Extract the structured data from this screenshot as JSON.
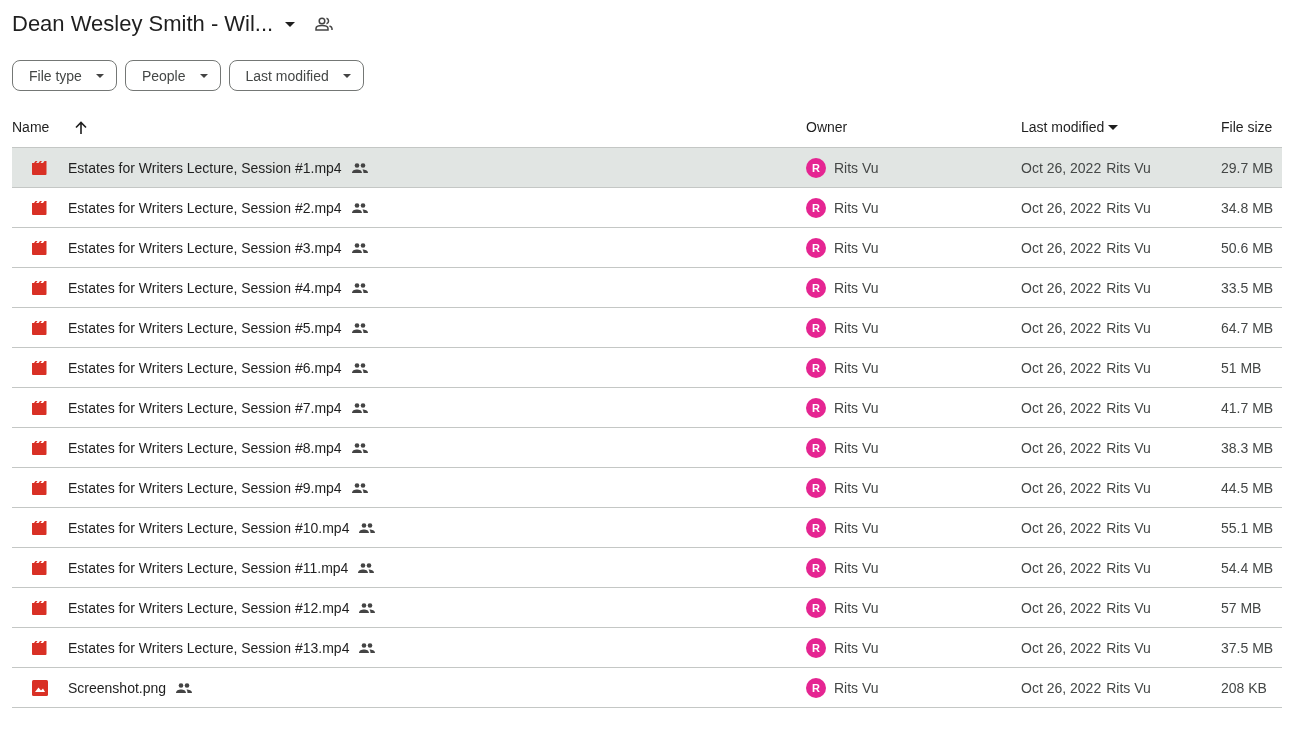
{
  "folder": {
    "title": "Dean Wesley Smith - Wil..."
  },
  "filters": [
    {
      "label": "File type"
    },
    {
      "label": "People"
    },
    {
      "label": "Last modified"
    }
  ],
  "table": {
    "columns": [
      {
        "label": "Name"
      },
      {
        "label": "Owner"
      },
      {
        "label": "Last modified"
      },
      {
        "label": "File size"
      }
    ],
    "rows": [
      {
        "kind": "video",
        "name": "Estates for Writers Lecture, Session #1.mp4",
        "owner_initial": "R",
        "owner": "Rits Vu",
        "modified": "Oct 26, 2022",
        "modified_by": "Rits Vu",
        "size": "29.7 MB",
        "selected": true
      },
      {
        "kind": "video",
        "name": "Estates for Writers Lecture, Session #2.mp4",
        "owner_initial": "R",
        "owner": "Rits Vu",
        "modified": "Oct 26, 2022",
        "modified_by": "Rits Vu",
        "size": "34.8 MB",
        "selected": false
      },
      {
        "kind": "video",
        "name": "Estates for Writers Lecture, Session #3.mp4",
        "owner_initial": "R",
        "owner": "Rits Vu",
        "modified": "Oct 26, 2022",
        "modified_by": "Rits Vu",
        "size": "50.6 MB",
        "selected": false
      },
      {
        "kind": "video",
        "name": "Estates for Writers Lecture, Session #4.mp4",
        "owner_initial": "R",
        "owner": "Rits Vu",
        "modified": "Oct 26, 2022",
        "modified_by": "Rits Vu",
        "size": "33.5 MB",
        "selected": false
      },
      {
        "kind": "video",
        "name": "Estates for Writers Lecture, Session #5.mp4",
        "owner_initial": "R",
        "owner": "Rits Vu",
        "modified": "Oct 26, 2022",
        "modified_by": "Rits Vu",
        "size": "64.7 MB",
        "selected": false
      },
      {
        "kind": "video",
        "name": "Estates for Writers Lecture, Session #6.mp4",
        "owner_initial": "R",
        "owner": "Rits Vu",
        "modified": "Oct 26, 2022",
        "modified_by": "Rits Vu",
        "size": "51 MB",
        "selected": false
      },
      {
        "kind": "video",
        "name": "Estates for Writers Lecture, Session #7.mp4",
        "owner_initial": "R",
        "owner": "Rits Vu",
        "modified": "Oct 26, 2022",
        "modified_by": "Rits Vu",
        "size": "41.7 MB",
        "selected": false
      },
      {
        "kind": "video",
        "name": "Estates for Writers Lecture, Session #8.mp4",
        "owner_initial": "R",
        "owner": "Rits Vu",
        "modified": "Oct 26, 2022",
        "modified_by": "Rits Vu",
        "size": "38.3 MB",
        "selected": false
      },
      {
        "kind": "video",
        "name": "Estates for Writers Lecture, Session #9.mp4",
        "owner_initial": "R",
        "owner": "Rits Vu",
        "modified": "Oct 26, 2022",
        "modified_by": "Rits Vu",
        "size": "44.5 MB",
        "selected": false
      },
      {
        "kind": "video",
        "name": "Estates for Writers Lecture, Session #10.mp4",
        "owner_initial": "R",
        "owner": "Rits Vu",
        "modified": "Oct 26, 2022",
        "modified_by": "Rits Vu",
        "size": "55.1 MB",
        "selected": false
      },
      {
        "kind": "video",
        "name": "Estates for Writers Lecture, Session #11.mp4",
        "owner_initial": "R",
        "owner": "Rits Vu",
        "modified": "Oct 26, 2022",
        "modified_by": "Rits Vu",
        "size": "54.4 MB",
        "selected": false
      },
      {
        "kind": "video",
        "name": "Estates for Writers Lecture, Session #12.mp4",
        "owner_initial": "R",
        "owner": "Rits Vu",
        "modified": "Oct 26, 2022",
        "modified_by": "Rits Vu",
        "size": "57 MB",
        "selected": false
      },
      {
        "kind": "video",
        "name": "Estates for Writers Lecture, Session #13.mp4",
        "owner_initial": "R",
        "owner": "Rits Vu",
        "modified": "Oct 26, 2022",
        "modified_by": "Rits Vu",
        "size": "37.5 MB",
        "selected": false
      },
      {
        "kind": "image",
        "name": "Screenshot.png",
        "owner_initial": "R",
        "owner": "Rits Vu",
        "modified": "Oct 26, 2022",
        "modified_by": "Rits Vu",
        "size": "208 KB",
        "selected": false
      }
    ]
  }
}
